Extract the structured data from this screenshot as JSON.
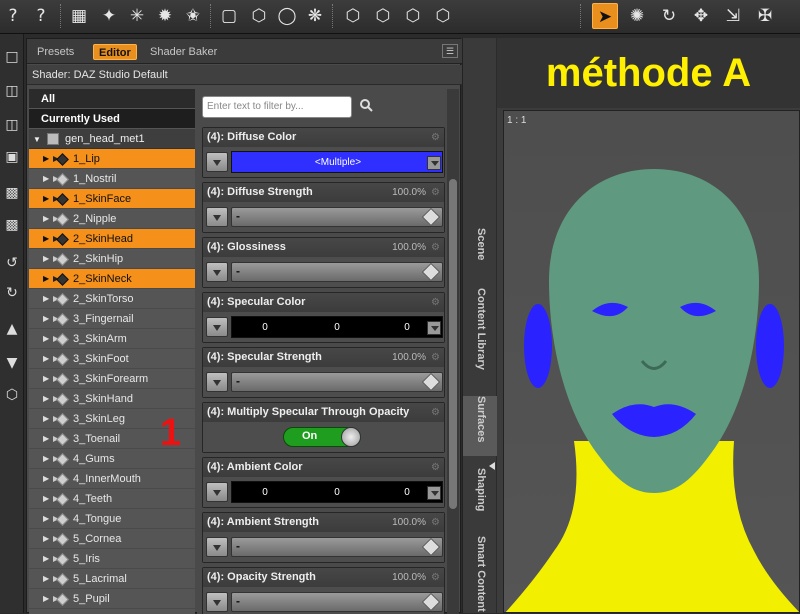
{
  "toolbar": {
    "left_glyphs": [
      "?",
      "?"
    ]
  },
  "panel": {
    "tabs": [
      "Presets",
      "Editor",
      "Shader Baker"
    ],
    "shader_label": "Shader: DAZ Studio Default"
  },
  "tree": {
    "headers": [
      "All",
      "Currently Used"
    ],
    "root": "gen_head_met1",
    "items": [
      {
        "label": "1_Lip",
        "selected": true
      },
      {
        "label": "1_Nostril",
        "selected": false
      },
      {
        "label": "1_SkinFace",
        "selected": true
      },
      {
        "label": "2_Nipple",
        "selected": false
      },
      {
        "label": "2_SkinHead",
        "selected": true
      },
      {
        "label": "2_SkinHip",
        "selected": false
      },
      {
        "label": "2_SkinNeck",
        "selected": true
      },
      {
        "label": "2_SkinTorso",
        "selected": false
      },
      {
        "label": "3_Fingernail",
        "selected": false
      },
      {
        "label": "3_SkinArm",
        "selected": false
      },
      {
        "label": "3_SkinFoot",
        "selected": false
      },
      {
        "label": "3_SkinForearm",
        "selected": false
      },
      {
        "label": "3_SkinHand",
        "selected": false
      },
      {
        "label": "3_SkinLeg",
        "selected": false
      },
      {
        "label": "3_Toenail",
        "selected": false
      },
      {
        "label": "4_Gums",
        "selected": false
      },
      {
        "label": "4_InnerMouth",
        "selected": false
      },
      {
        "label": "4_Teeth",
        "selected": false
      },
      {
        "label": "4_Tongue",
        "selected": false
      },
      {
        "label": "5_Cornea",
        "selected": false
      },
      {
        "label": "5_Iris",
        "selected": false
      },
      {
        "label": "5_Lacrimal",
        "selected": false
      },
      {
        "label": "5_Pupil",
        "selected": false
      }
    ]
  },
  "filter": {
    "placeholder": "Enter text to filter by..."
  },
  "properties": [
    {
      "title": "(4): Diffuse Color",
      "kind": "color",
      "text": "<Multiple>",
      "color": "#2f2fff"
    },
    {
      "title": "(4): Diffuse Strength",
      "kind": "slider",
      "pct": "100.0%"
    },
    {
      "title": "(4): Glossiness",
      "kind": "slider",
      "pct": "100.0%"
    },
    {
      "title": "(4): Specular Color",
      "kind": "rgb",
      "values": [
        "0",
        "0",
        "0"
      ]
    },
    {
      "title": "(4): Specular Strength",
      "kind": "slider",
      "pct": "100.0%"
    },
    {
      "title": "(4): Multiply Specular Through Opacity",
      "kind": "toggle",
      "text": "On"
    },
    {
      "title": "(4): Ambient Color",
      "kind": "rgb",
      "values": [
        "0",
        "0",
        "0"
      ]
    },
    {
      "title": "(4): Ambient Strength",
      "kind": "slider",
      "pct": "100.0%"
    },
    {
      "title": "(4): Opacity Strength",
      "kind": "slider",
      "pct": "100.0%"
    }
  ],
  "side_tabs": [
    "Scene",
    "Content Library",
    "Surfaces",
    "Shaping",
    "Smart Content"
  ],
  "viewport": {
    "title": "méthode A",
    "label": "1 : 1",
    "colors": {
      "head": "#5f9a80",
      "neck": "#f2f000",
      "features": "#2a22ff"
    }
  },
  "annotation": "1"
}
